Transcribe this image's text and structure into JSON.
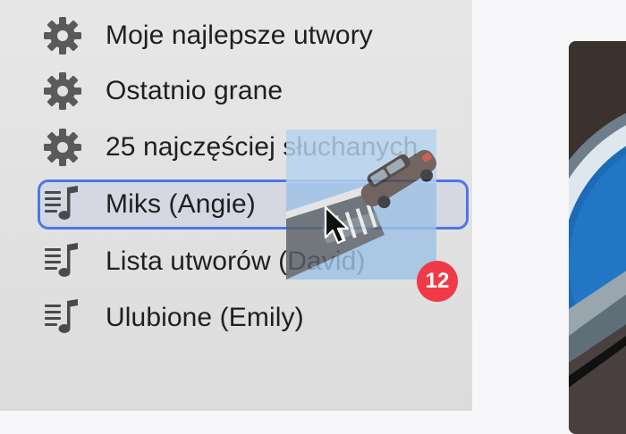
{
  "sidebar": {
    "items": [
      {
        "label": "Moje najlepsze utwory",
        "icon": "gear-icon",
        "selected": false
      },
      {
        "label": "Ostatnio grane",
        "icon": "gear-icon",
        "selected": false
      },
      {
        "label": "25 najczęściej słuchanych",
        "icon": "gear-icon",
        "selected": false
      },
      {
        "label": "Miks (Angie)",
        "icon": "playlist-icon",
        "selected": true
      },
      {
        "label": "Lista utworów (David)",
        "icon": "playlist-icon",
        "selected": false
      },
      {
        "label": "Ulubione (Emily)",
        "icon": "playlist-icon",
        "selected": false
      }
    ]
  },
  "drag": {
    "item_count": "12"
  },
  "colors": {
    "selection_border": "#4b78e6",
    "badge": "#f03a47",
    "icon": "#5a5a5a"
  }
}
